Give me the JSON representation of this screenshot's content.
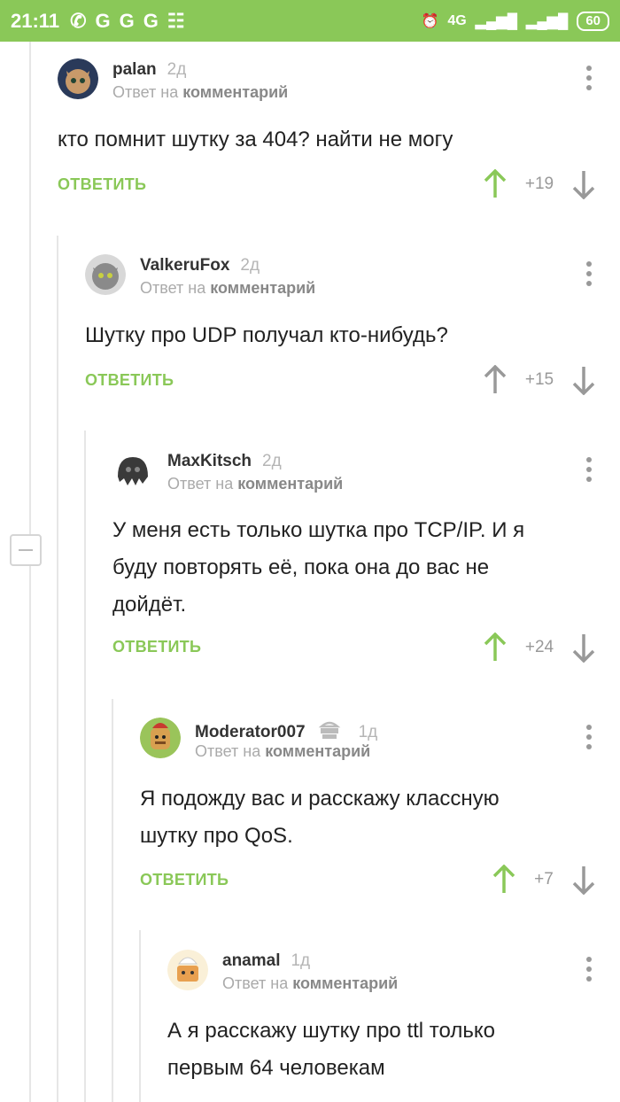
{
  "status_bar": {
    "time": "21:11",
    "network": "4G",
    "battery": "60"
  },
  "comments": [
    {
      "user": "palan",
      "age": "2д",
      "reply_prefix": "Ответ на",
      "reply_target": "комментарий",
      "text": "кто помнит шутку за 404? найти не могу",
      "reply_label": "ОТВЕТИТЬ",
      "score": "+19",
      "voted_up": true
    },
    {
      "user": "ValkeruFox",
      "age": "2д",
      "reply_prefix": "Ответ на",
      "reply_target": "комментарий",
      "text": "Шутку про UDP получал кто-нибудь?",
      "reply_label": "ОТВЕТИТЬ",
      "score": "+15",
      "voted_up": false
    },
    {
      "user": "MaxKitsch",
      "age": "2д",
      "reply_prefix": "Ответ на",
      "reply_target": "комментарий",
      "text": "У меня есть только шутка про TCP/IP. И я буду повторять её, пока она до вас не дойдёт.",
      "reply_label": "ОТВЕТИТЬ",
      "score": "+24",
      "voted_up": true
    },
    {
      "user": "Moderator007",
      "age": "1д",
      "reply_prefix": "Ответ на",
      "reply_target": "комментарий",
      "text": "Я подожду вас и расскажу классную шутку про QoS.",
      "reply_label": "ОТВЕТИТЬ",
      "score": "+7",
      "voted_up": true
    },
    {
      "user": "anamal",
      "age": "1д",
      "reply_prefix": "Ответ на",
      "reply_target": "комментарий",
      "text": "А я расскажу шутку про ttl только первым 64 человекам"
    }
  ],
  "colors": {
    "accent": "#8ac858",
    "vote_up_active": "#8ac858",
    "vote_neutral": "#999999"
  }
}
